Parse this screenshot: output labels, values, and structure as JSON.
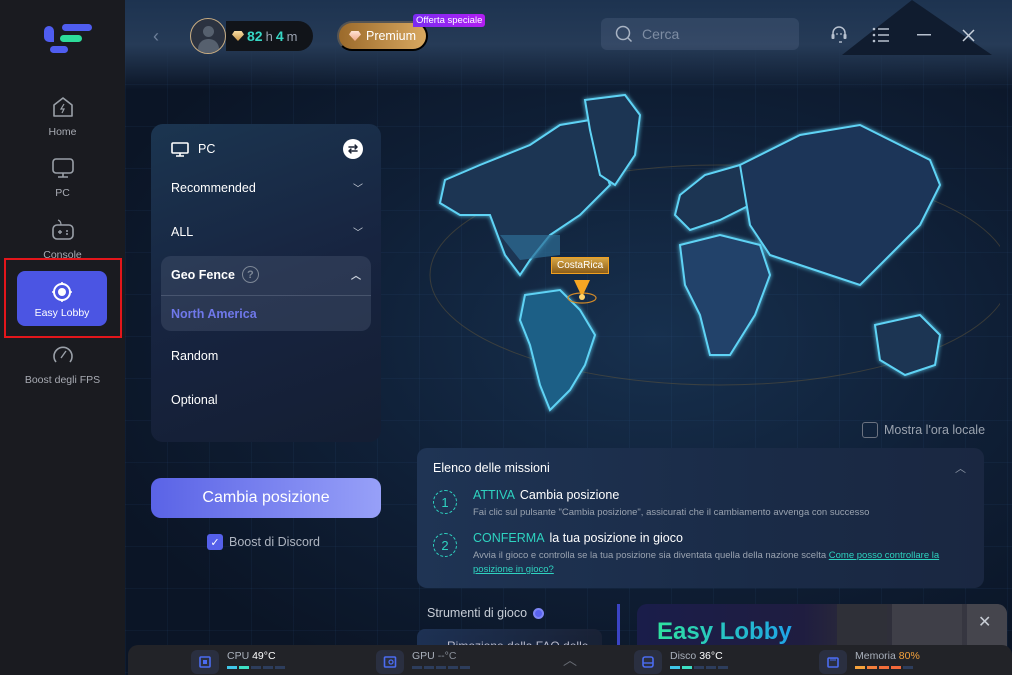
{
  "sidebar": {
    "items": [
      {
        "label": "Home",
        "icon": "home-icon"
      },
      {
        "label": "PC",
        "icon": "monitor-icon"
      },
      {
        "label": "Console",
        "icon": "gamepad-icon"
      },
      {
        "label": "Easy Lobby",
        "icon": "target-icon",
        "active": true
      },
      {
        "label": "Boost degli FPS",
        "icon": "speedometer-icon"
      }
    ]
  },
  "topbar": {
    "time_hours": "82",
    "time_h_unit": "h",
    "time_minutes": "4",
    "time_m_unit": "m",
    "premium_label": "Premium",
    "offer_badge": "Offerta speciale",
    "search_placeholder": "Cerca"
  },
  "panel": {
    "platform": "PC",
    "dropdown1": "Recommended",
    "dropdown2": "ALL",
    "geo_fence_label": "Geo Fence",
    "geo_fence_help": "?",
    "geo_fence_selected": "North America",
    "option_random": "Random",
    "option_optional": "Optional",
    "cta_label": "Cambia posizione",
    "discord_label": "Boost di Discord",
    "discord_checked": true
  },
  "map": {
    "selected_location": "CostaRica",
    "show_local_time_label": "Mostra l'ora locale",
    "show_local_time_checked": false
  },
  "missions": {
    "title": "Elenco delle missioni",
    "steps": [
      {
        "num": "1",
        "tag": "ATTIVA",
        "title": "Cambia posizione",
        "desc": "Fai clic sul pulsante \"Cambia posizione\", assicurati che il cambiamento avvenga con successo"
      },
      {
        "num": "2",
        "tag": "CONFERMA",
        "title": "la tua posizione in gioco",
        "desc": "Avvia il gioco e controlla se la tua posizione sia diventata quella della nazione scelta",
        "link": "Come posso controllare la posizione in gioco?"
      }
    ]
  },
  "tools": {
    "title": "Strumenti di gioco",
    "card_partial": "Rimozione della FAQ delle"
  },
  "promo": {
    "title": "Easy Lobby"
  },
  "status": {
    "cpu": {
      "label": "CPU",
      "value": "49°C",
      "level": 2
    },
    "gpu": {
      "label": "GPU",
      "value": "--°C",
      "level": 0
    },
    "disk": {
      "label": "Disco",
      "value": "36°C",
      "level": 2
    },
    "memory": {
      "label": "Memoria",
      "value": "80%",
      "level": 4
    }
  },
  "colors": {
    "accent": "#4b55e3",
    "teal": "#2ed3c0",
    "warning": "#f5a23c",
    "highlight_box": "#e3161b"
  }
}
